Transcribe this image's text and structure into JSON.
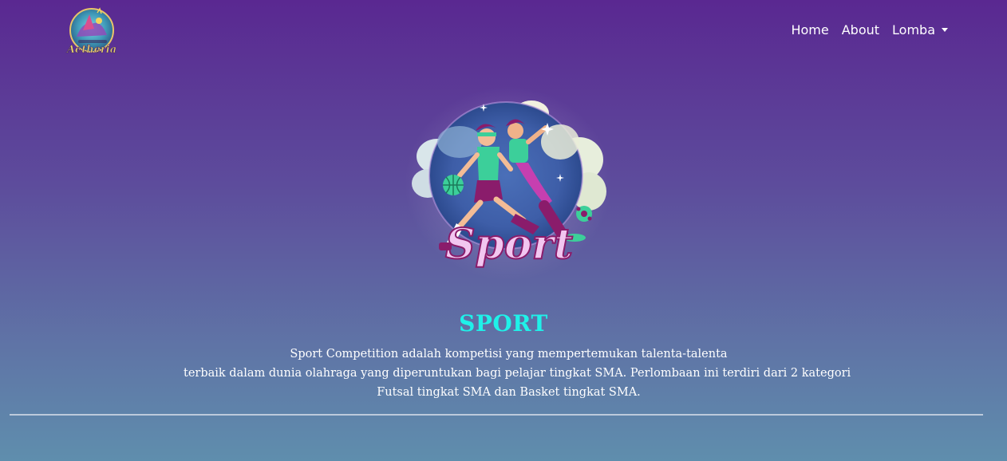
{
  "navbar": {
    "brand_logo_text": "Aetheria",
    "links": [
      {
        "label": "Home"
      },
      {
        "label": "About"
      },
      {
        "label": "Lomba"
      }
    ]
  },
  "hero": {
    "image_text": "Sport"
  },
  "content": {
    "title": "SPORT",
    "description_lines": [
      "Sport Competition adalah kompetisi yang mempertemukan talenta-talenta",
      "terbaik dalam dunia olahraga yang diperuntukan bagi pelajar tingkat SMA. Perlombaan ini terdiri dari 2 kategori",
      "Futsal tingkat SMA dan Basket tingkat SMA."
    ]
  },
  "colors": {
    "title": "#1ff1e9",
    "background_top": "#5a2891",
    "background_bottom": "#5f8ead"
  }
}
